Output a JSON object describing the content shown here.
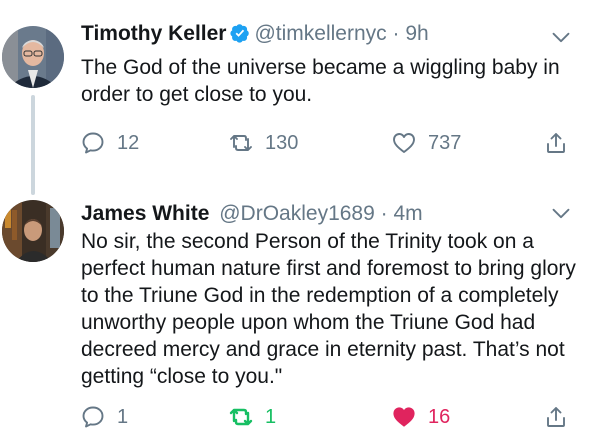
{
  "tweets": [
    {
      "name": "Timothy Keller",
      "verified": true,
      "handle": "@timkellernyc",
      "separator": "·",
      "time": "9h",
      "text": "The God of the universe became a wiggling baby in order to get close to you.",
      "replies": "12",
      "retweets": "130",
      "likes": "737",
      "retweeted": false,
      "liked": false,
      "avatar_icon": "person-photo"
    },
    {
      "name": "James White",
      "verified": false,
      "handle": "@DrOakley1689",
      "separator": "·",
      "time": "4m",
      "text": "No sir, the second Person of the Trinity took on a perfect human nature first and foremost to bring glory to the Triune God in the redemption of a completely unworthy people upon whom the Triune God had decreed mercy and grace in eternity past. That’s not getting “close to you.\"",
      "replies": "1",
      "retweets": "1",
      "likes": "16",
      "retweeted": true,
      "liked": true,
      "avatar_icon": "person-photo"
    }
  ],
  "colors": {
    "text": "#14171a",
    "secondary": "#657786",
    "verified": "#1da1f2",
    "retweet_active": "#17bf63",
    "like_active": "#e0245e",
    "thread_line": "#ccd6dd"
  },
  "icons": {
    "reply": "reply-icon",
    "retweet": "retweet-icon",
    "like": "heart-icon",
    "share": "share-icon",
    "menu": "chevron-down-icon",
    "verified": "verified-badge-icon"
  }
}
